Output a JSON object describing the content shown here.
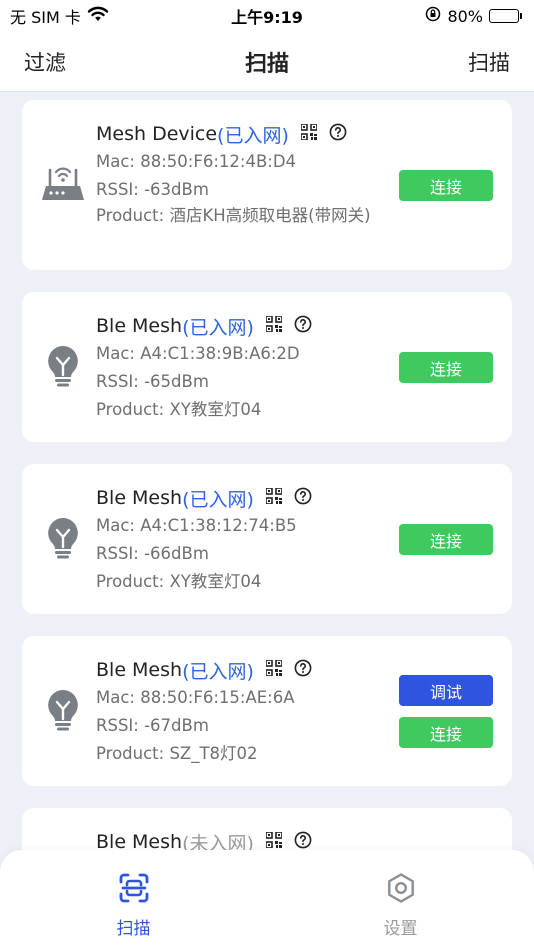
{
  "status_bar": {
    "carrier": "无 SIM 卡",
    "time": "上午9:19",
    "battery": "80%",
    "battery_level": 0.8
  },
  "nav": {
    "left": "过滤",
    "title": "扫描",
    "right": "扫描"
  },
  "labels": {
    "mac": "Mac: ",
    "rssi": "RSSI: ",
    "product": "Product: "
  },
  "devices": [
    {
      "name": "Mesh Device",
      "status": "(已入网)",
      "icon": "router-icon",
      "mac": "88:50:F6:12:4B:D4",
      "rssi": "-63dBm",
      "product": "酒店KH高频取电器(带网关)",
      "buttons": [
        "连接"
      ]
    },
    {
      "name": "Ble Mesh",
      "status": "(已入网)",
      "icon": "bulb-icon",
      "mac": "A4:C1:38:9B:A6:2D",
      "rssi": "-65dBm",
      "product": "XY教室灯04",
      "buttons": [
        "连接"
      ]
    },
    {
      "name": "Ble Mesh",
      "status": "(已入网)",
      "icon": "bulb-icon",
      "mac": "A4:C1:38:12:74:B5",
      "rssi": "-66dBm",
      "product": "XY教室灯04",
      "buttons": [
        "连接"
      ]
    },
    {
      "name": "Ble Mesh",
      "status": "(已入网)",
      "icon": "bulb-icon",
      "mac": "88:50:F6:15:AE:6A",
      "rssi": "-67dBm",
      "product": "SZ_T8灯02",
      "buttons": [
        "调试",
        "连接"
      ]
    },
    {
      "name": "Ble Mesh",
      "status": "(未入网)",
      "icon": "bulb-icon"
    }
  ],
  "tabbar": {
    "scan": "扫描",
    "settings": "设置"
  },
  "colors": {
    "accent": "#2f55e0",
    "status_blue": "#2f64e0",
    "connect_green": "#3fc95f",
    "background": "#eef0f8"
  }
}
